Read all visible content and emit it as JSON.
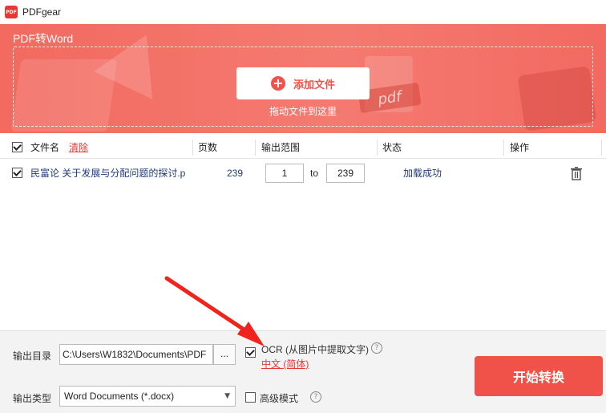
{
  "window": {
    "title": "PDFgear",
    "logo_text": "PDF"
  },
  "banner": {
    "title": "PDF转Word",
    "add_file_label": "添加文件",
    "drag_hint": "拖动文件到这里",
    "deco_pdf_text": "pdf"
  },
  "table": {
    "headers": {
      "filename": "文件名",
      "clear": "清除",
      "pages": "页数",
      "range": "输出范围",
      "status": "状态",
      "action": "操作"
    },
    "rows": [
      {
        "checked": true,
        "filename": "民富论 关于发展与分配问题的探讨.p",
        "pages": "239",
        "range_from": "1",
        "range_to_word": "to",
        "range_to": "239",
        "status": "加载成功"
      }
    ]
  },
  "bottom": {
    "output_dir_label": "输出目录",
    "output_dir_value": "C:\\Users\\W1832\\Documents\\PDF",
    "browse_label": "...",
    "ocr_label": "OCR (从图片中提取文字)",
    "ocr_checked": true,
    "ocr_language": "中文 (简体)",
    "output_type_label": "输出类型",
    "output_type_value": "Word Documents (*.docx)",
    "advanced_label": "高级模式",
    "advanced_checked": false,
    "start_button": "开始转换"
  },
  "colors": {
    "accent": "#f0524a",
    "link": "#e53935",
    "annotation_arrow": "#f0241c"
  }
}
